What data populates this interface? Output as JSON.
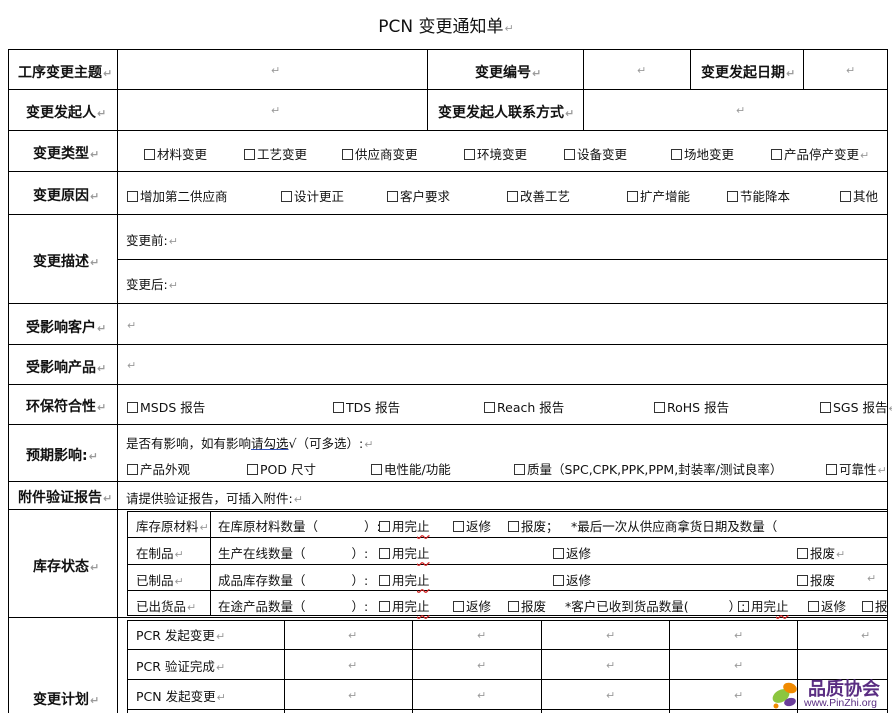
{
  "title": "PCN 变更通知单",
  "ret": "↵",
  "header": {
    "subject": "工序变更主题",
    "change_no": "变更编号",
    "start_date": "变更发起日期",
    "initiator": "变更发起人",
    "contact": "变更发起人联系方式"
  },
  "change_type": {
    "label": "变更类型",
    "options": [
      "材料变更",
      "工艺变更",
      "供应商变更",
      "环境变更",
      "设备变更",
      "场地变更",
      "产品停产变更"
    ]
  },
  "change_reason": {
    "label": "变更原因",
    "options": [
      "增加第二供应商",
      "设计更正",
      "客户要求",
      "改善工艺",
      "扩产增能",
      "节能降本",
      "其他"
    ]
  },
  "description": {
    "label": "变更描述",
    "before": "变更前:",
    "after": "变更后:"
  },
  "affected_customer": "受影响客户",
  "affected_product": "受影响产品",
  "env": {
    "label": "环保符合性",
    "options": [
      "MSDS 报告",
      "TDS 报告",
      "Reach 报告",
      "RoHS 报告",
      "SGS 报告"
    ]
  },
  "impact": {
    "label": "预期影响:",
    "prompt_a": "是否有影响，如有影响",
    "prompt_b": "请勾选",
    "prompt_c": "√（可多选）:",
    "options": [
      "产品外观",
      "POD 尺寸",
      "电性能/功能",
      "质量（SPC,CPK,PPK,PPM,封装率/测试良率）",
      "可靠性"
    ]
  },
  "attachment": {
    "label": "附件验证报告",
    "text": "请提供验证报告，可插入附件:"
  },
  "inventory": {
    "label": "库存状态",
    "finish_pre": "用完",
    "finish_sq": "止",
    "rework": "返修",
    "scrap": "报废",
    "rows": [
      {
        "name": "库存原材料",
        "desc": "在库原材料数量（",
        "extra": "*最后一次从供应商拿货日期及数量（",
        "scrap_suffix": "；"
      },
      {
        "name": "在制品",
        "desc": "生产在线数量（"
      },
      {
        "name": "已制品",
        "desc": "成品库存数量（"
      },
      {
        "name": "已出货品",
        "desc": "在途产品数量（",
        "extra": "*客户已收到货品数量(",
        "scrap2": "报"
      }
    ],
    "close": "）:"
  },
  "plan": {
    "label": "变更计划",
    "rows": [
      "PCR 发起变更",
      "PCR 验证完成",
      "PCN 发起变更"
    ]
  },
  "watermark": {
    "brand": "品质协会",
    "url": "www.PinZhi.org"
  },
  "colors": {
    "squiggle": "#d02020",
    "logo_orange": "#f08a00",
    "logo_green": "#8cc63f",
    "logo_purple": "#6a3d9a"
  }
}
